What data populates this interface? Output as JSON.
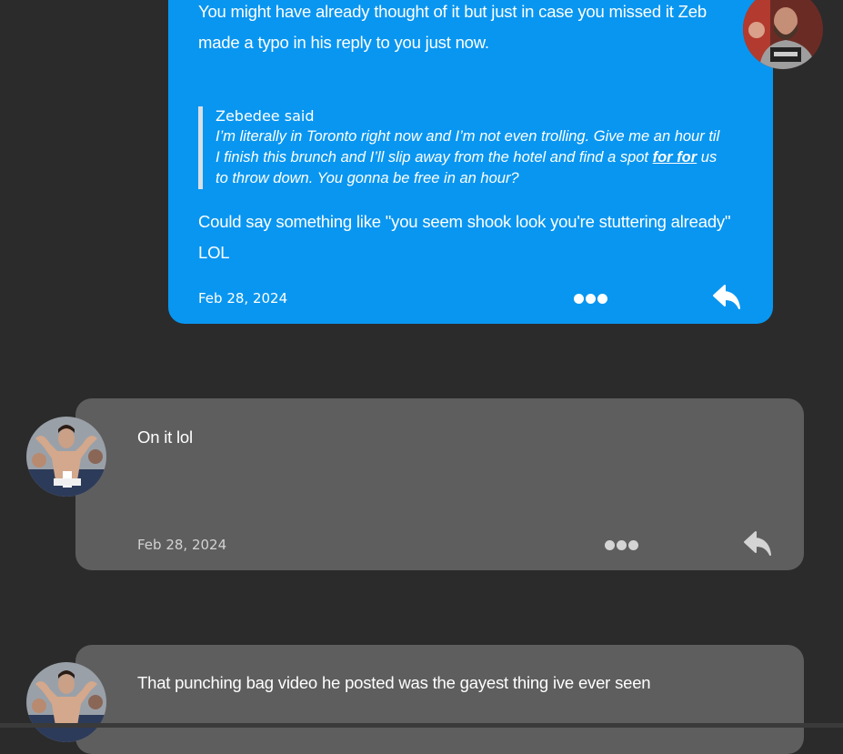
{
  "posts": [
    {
      "intro": "You might have already thought of it but just in case you missed it Zeb made a typo in his reply to you just now.",
      "quote": {
        "author": "Zebedee said",
        "text_before": "I’m literally in Toronto right now and I’m not even trolling. Give me an hour til I finish this brunch and I’ll slip away from the hotel and find a spot ",
        "emphasis": "for for",
        "text_after": " us to throw down. You gonna be free in an hour?"
      },
      "outro": "Could say something like \"you seem shook look you're stuttering already\" LOL",
      "date": "Feb 28, 2024",
      "avatar_icon": "bearded-man-avatar"
    },
    {
      "text": "On it lol",
      "date": "Feb 28, 2024",
      "avatar_icon": "bodybuilder-avatar"
    },
    {
      "text": "That punching bag video he posted was the gayest thing ive ever seen",
      "avatar_icon": "bodybuilder-avatar"
    }
  ],
  "colors": {
    "background": "#2b2b2b",
    "own_bubble": "#0996f0",
    "other_bubble": "#5e5e5e"
  },
  "icons": {
    "more": "more-dots-icon",
    "reply": "reply-arrow-icon"
  }
}
